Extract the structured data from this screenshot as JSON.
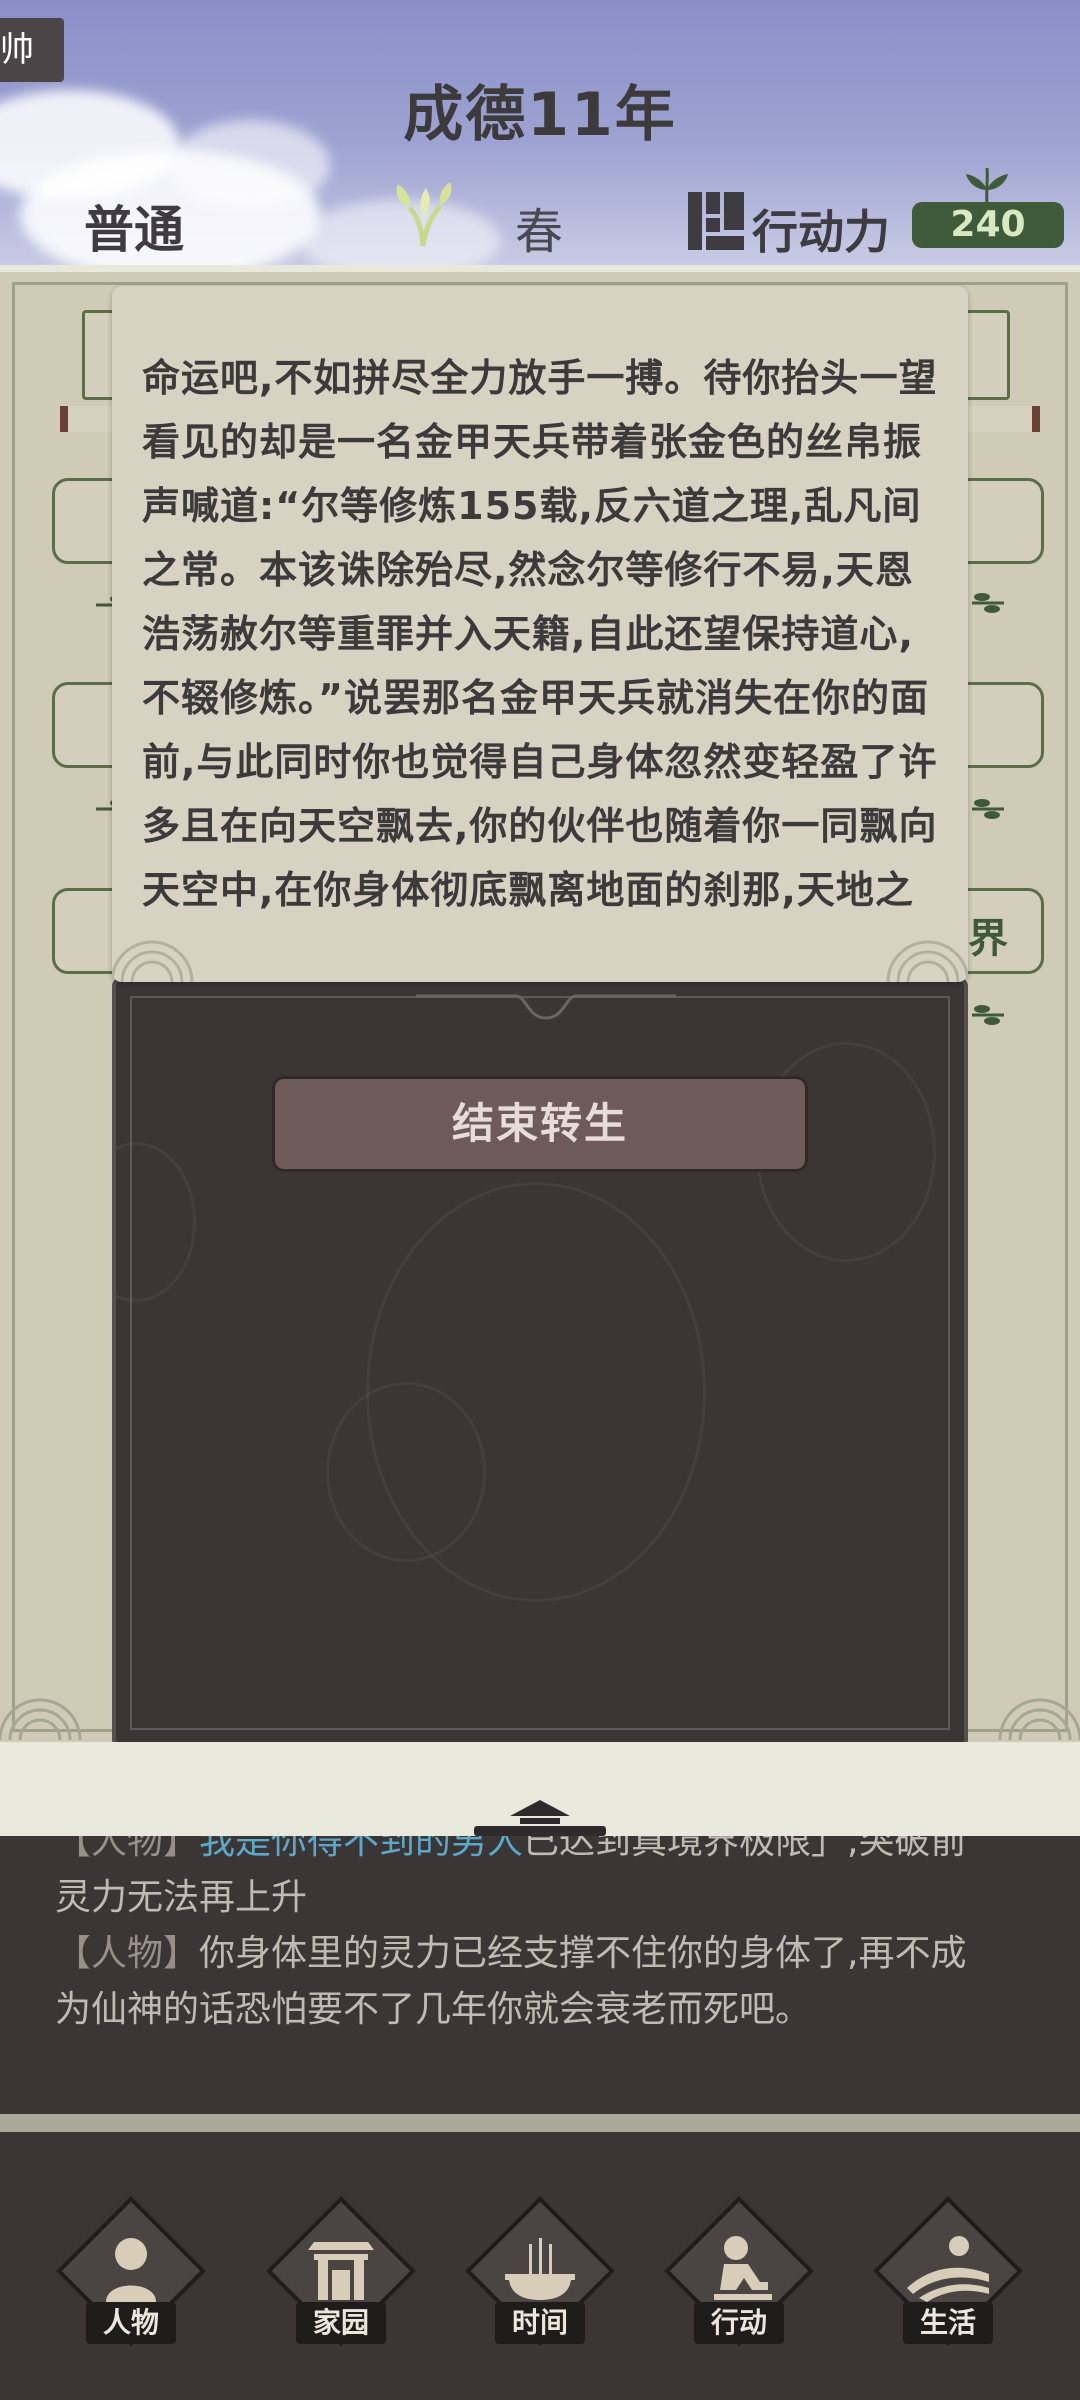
{
  "header": {
    "corner_tab": "帅",
    "title": "成德11年",
    "mode": "普通",
    "season": "春",
    "action_label": "行动力",
    "action_points": "240"
  },
  "background": {
    "world_label": "界"
  },
  "modal": {
    "story_text": "命运吧,不如拼尽全力放手一搏。待你抬头一望看见的却是一名金甲天兵带着张金色的丝帛振声喊道:“尔等修炼155载,反六道之理,乱凡间之常。本该诛除殆尽,然念尔等修行不易,天恩浩荡赦尔等重罪并入天籍,自此还望保持道心,不辍修炼。”说罢那名金甲天兵就消失在你的面前,与此同时你也觉得自己身体忽然变轻盈了许多且在向天空飘去,你的伙伴也随着你一同飘向天空中,在你身体彻底飘离地面的刹那,天地之间似乎都安静了下来。",
    "end_button": "结束转生"
  },
  "log": {
    "line1_tag": "【人物】",
    "line1_name": "我是你得不到的男人",
    "line1_text": "已达到真境界极限」,突破前",
    "line2_text": "灵力无法再上升",
    "line3_tag": "【人物】",
    "line3_text": "你身体里的灵力已经支撑不住你的身体了,再不成",
    "line4_text": "为仙神的话恐怕要不了几年你就会衰老而死吧。"
  },
  "nav": {
    "items": [
      {
        "label": "人物",
        "icon": "person-icon"
      },
      {
        "label": "家园",
        "icon": "gate-icon"
      },
      {
        "label": "时间",
        "icon": "incense-icon"
      },
      {
        "label": "行动",
        "icon": "kneel-icon"
      },
      {
        "label": "生活",
        "icon": "landscape-icon"
      }
    ]
  },
  "colors": {
    "sky": "#8a8fc8",
    "paper": "#d6d3c3",
    "dark": "#3b3536",
    "green": "#3f5a3a",
    "link": "#5aa9c9"
  }
}
